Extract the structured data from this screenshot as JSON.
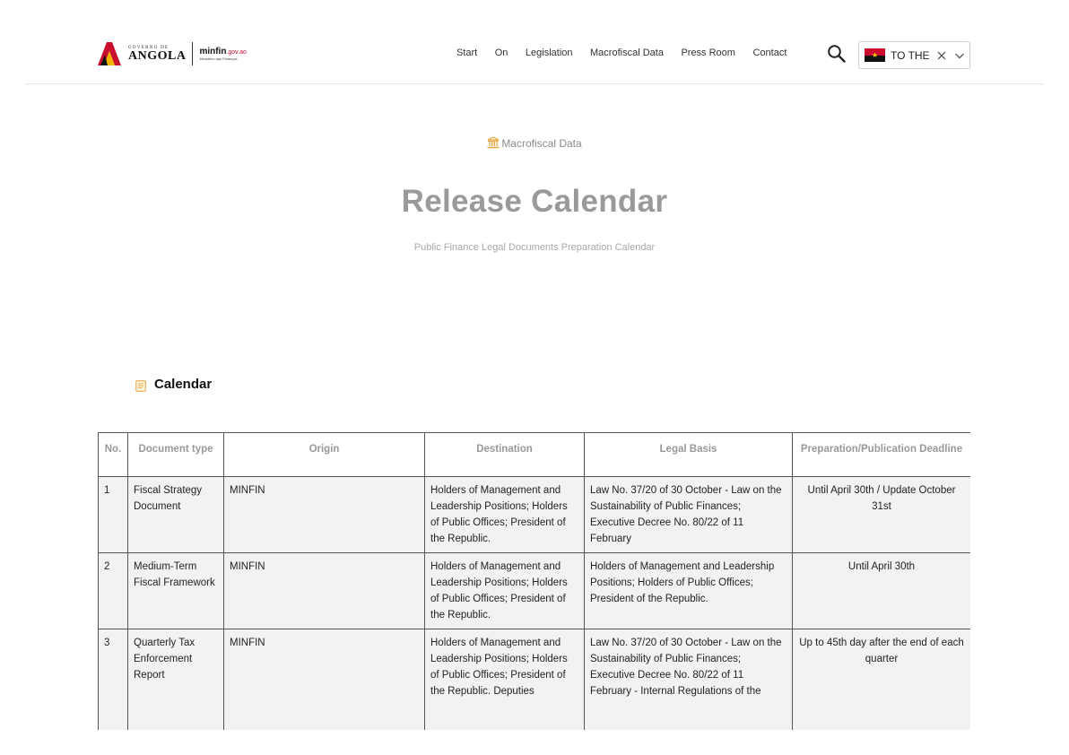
{
  "header": {
    "logo": {
      "gov_small": "GOVERNO DE",
      "gov_big": "ANGOLA",
      "minfin_main": "minfin",
      "minfin_domain": ".gov.ao",
      "minfin_sub": "Ministério das Finanças"
    },
    "nav": [
      "Start",
      "On",
      "Legislation",
      "Macrofiscal Data",
      "Press Room",
      "Contact"
    ],
    "language": {
      "label": "TO THE",
      "flag": "angola-flag"
    },
    "icons": {
      "search": "search-icon",
      "clear": "close-icon",
      "dropdown": "chevron-down-icon"
    }
  },
  "hero": {
    "breadcrumb": "Macrofiscal Data",
    "title": "Release Calendar",
    "subtitle": "Public Finance Legal Documents Preparation Calendar"
  },
  "section": {
    "title": "Calendar"
  },
  "table": {
    "headers": [
      "No.",
      "Document type",
      "Origin",
      "Destination",
      "Legal Basis",
      "Preparation/Publication Deadline"
    ],
    "rows": [
      {
        "no": "1",
        "type": "Fiscal Strategy Document",
        "origin": "MINFIN",
        "destination": "Holders of Management and Leadership Positions; Holders of Public Offices; President of the Republic.",
        "legal": "Law No. 37/20 of 30 October - Law on the Sustainability of Public Finances; Executive Decree No. 80/22 of 11 February",
        "deadline": "Until April 30th / Update October 31st"
      },
      {
        "no": "2",
        "type": "Medium-Term Fiscal Framework",
        "origin": "MINFIN",
        "destination": "Holders of Management and Leadership Positions; Holders of Public Offices; President of the Republic.",
        "legal": "Holders of Management and Leadership Positions; Holders of Public Offices; President of the Republic.",
        "deadline": "Until April 30th"
      },
      {
        "no": "3",
        "type": "Quarterly Tax Enforcement Report",
        "origin": "MINFIN",
        "destination": "Holders of Management and Leadership Positions; Holders of Public Offices; President of the Republic. Deputies",
        "legal": "Law No. 37/20 of 30 October - Law on the Sustainability of Public Finances; Executive Decree No. 80/22 of 11 February - Internal Regulations of the",
        "deadline": "Up to 45th day after the end of each quarter"
      }
    ]
  },
  "colors": {
    "accent_gold": "#e8a33a",
    "title_gray": "#9a9a9a",
    "flag_red": "#cc092f",
    "flag_black": "#111111",
    "row_bg": "#f2f2f2"
  }
}
